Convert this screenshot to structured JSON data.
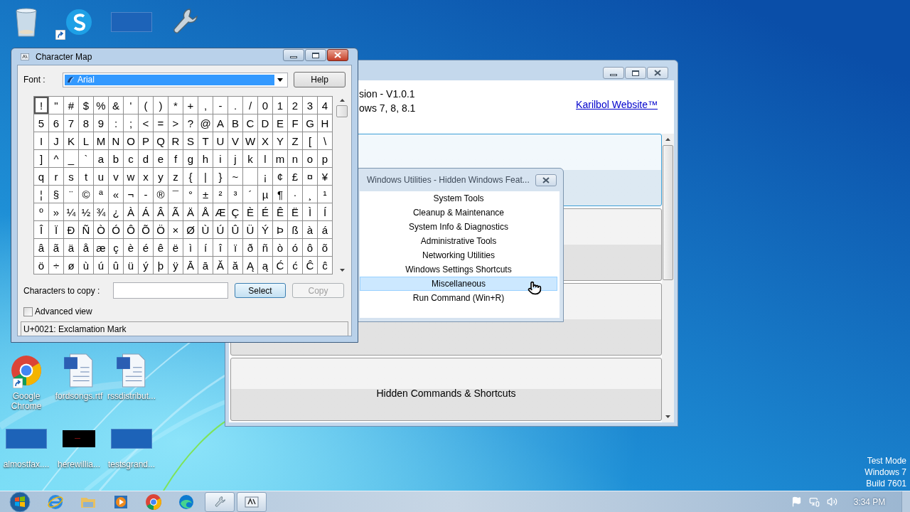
{
  "desktop": {
    "top_icons": [
      {
        "kind": "recycle-bin",
        "shortcut": false
      },
      {
        "kind": "skype",
        "shortcut": true
      },
      {
        "kind": "thumbnail",
        "shortcut": false
      },
      {
        "kind": "wrench",
        "shortcut": false
      }
    ],
    "icons": [
      {
        "kind": "chrome",
        "label": "Google Chrome",
        "shortcut": true
      },
      {
        "kind": "word",
        "label": "fordsongs.rtf",
        "shortcut": false
      },
      {
        "kind": "word",
        "label": "rssdistribut...",
        "shortcut": false
      },
      {
        "kind": "thumbnail",
        "label": "almostfax....",
        "shortcut": false
      },
      {
        "kind": "dark-thumbnail",
        "label": "herewillia...",
        "shortcut": false
      },
      {
        "kind": "thumbnail",
        "label": "testsgrand...",
        "shortcut": false
      }
    ],
    "test_mode": [
      "Test Mode",
      "Windows 7",
      "Build 7601"
    ]
  },
  "app": {
    "lines": [
      "sion - V1.0.1",
      "ows 7, 8, 8.1"
    ],
    "link": "Karilbol Website™",
    "buttons": [
      {
        "selected": true
      },
      {
        "selected": false
      },
      {
        "selected": false
      },
      {
        "label": "Hidden Commands & Shortcuts",
        "selected": false
      }
    ]
  },
  "popup": {
    "title": "Windows Utilities - Hidden Windows Feat...",
    "items": [
      {
        "label": "System Tools",
        "selected": false
      },
      {
        "label": "Cleanup & Maintenance",
        "selected": false
      },
      {
        "label": "System Info & Diagnostics",
        "selected": false
      },
      {
        "label": "Administrative Tools",
        "selected": false
      },
      {
        "label": "Networking Utilities",
        "selected": false
      },
      {
        "label": "Windows Settings Shortcuts",
        "selected": false
      },
      {
        "label": "Miscellaneous",
        "selected": true
      },
      {
        "label": "Run Command (Win+R)",
        "selected": false
      }
    ]
  },
  "charmap": {
    "title": "Character Map",
    "font_label": "Font :",
    "font_value": "Arial",
    "help": "Help",
    "grid": [
      [
        {
          "c": "!",
          "selected": true
        },
        {
          "c": "\"",
          "selected": false
        },
        {
          "c": "#",
          "selected": false
        },
        {
          "c": "$",
          "selected": false
        },
        {
          "c": "%",
          "selected": false
        },
        {
          "c": "&",
          "selected": false
        },
        {
          "c": "'",
          "selected": false
        },
        {
          "c": "(",
          "selected": false
        },
        {
          "c": ")",
          "selected": false
        },
        {
          "c": "*",
          "selected": false
        },
        {
          "c": "+",
          "selected": false
        },
        {
          "c": ",",
          "selected": false
        },
        {
          "c": "-",
          "selected": false
        },
        {
          "c": ".",
          "selected": false
        },
        {
          "c": "/",
          "selected": false
        },
        {
          "c": "0",
          "selected": false
        },
        {
          "c": "1",
          "selected": false
        },
        {
          "c": "2",
          "selected": false
        },
        {
          "c": "3",
          "selected": false
        },
        {
          "c": "4",
          "selected": false
        }
      ],
      [
        {
          "c": "5",
          "selected": false
        },
        {
          "c": "6",
          "selected": false
        },
        {
          "c": "7",
          "selected": false
        },
        {
          "c": "8",
          "selected": false
        },
        {
          "c": "9",
          "selected": false
        },
        {
          "c": ":",
          "selected": false
        },
        {
          "c": ";",
          "selected": false
        },
        {
          "c": "<",
          "selected": false
        },
        {
          "c": "=",
          "selected": false
        },
        {
          "c": ">",
          "selected": false
        },
        {
          "c": "?",
          "selected": false
        },
        {
          "c": "@",
          "selected": false
        },
        {
          "c": "A",
          "selected": false
        },
        {
          "c": "B",
          "selected": false
        },
        {
          "c": "C",
          "selected": false
        },
        {
          "c": "D",
          "selected": false
        },
        {
          "c": "E",
          "selected": false
        },
        {
          "c": "F",
          "selected": false
        },
        {
          "c": "G",
          "selected": false
        },
        {
          "c": "H",
          "selected": false
        }
      ],
      [
        {
          "c": "I",
          "selected": false
        },
        {
          "c": "J",
          "selected": false
        },
        {
          "c": "K",
          "selected": false
        },
        {
          "c": "L",
          "selected": false
        },
        {
          "c": "M",
          "selected": false
        },
        {
          "c": "N",
          "selected": false
        },
        {
          "c": "O",
          "selected": false
        },
        {
          "c": "P",
          "selected": false
        },
        {
          "c": "Q",
          "selected": false
        },
        {
          "c": "R",
          "selected": false
        },
        {
          "c": "S",
          "selected": false
        },
        {
          "c": "T",
          "selected": false
        },
        {
          "c": "U",
          "selected": false
        },
        {
          "c": "V",
          "selected": false
        },
        {
          "c": "W",
          "selected": false
        },
        {
          "c": "X",
          "selected": false
        },
        {
          "c": "Y",
          "selected": false
        },
        {
          "c": "Z",
          "selected": false
        },
        {
          "c": "[",
          "selected": false
        },
        {
          "c": "\\",
          "selected": false
        }
      ],
      [
        {
          "c": "]",
          "selected": false
        },
        {
          "c": "^",
          "selected": false
        },
        {
          "c": "_",
          "selected": false
        },
        {
          "c": "`",
          "selected": false
        },
        {
          "c": "a",
          "selected": false
        },
        {
          "c": "b",
          "selected": false
        },
        {
          "c": "c",
          "selected": false
        },
        {
          "c": "d",
          "selected": false
        },
        {
          "c": "e",
          "selected": false
        },
        {
          "c": "f",
          "selected": false
        },
        {
          "c": "g",
          "selected": false
        },
        {
          "c": "h",
          "selected": false
        },
        {
          "c": "i",
          "selected": false
        },
        {
          "c": "j",
          "selected": false
        },
        {
          "c": "k",
          "selected": false
        },
        {
          "c": "l",
          "selected": false
        },
        {
          "c": "m",
          "selected": false
        },
        {
          "c": "n",
          "selected": false
        },
        {
          "c": "o",
          "selected": false
        },
        {
          "c": "p",
          "selected": false
        }
      ],
      [
        {
          "c": "q",
          "selected": false
        },
        {
          "c": "r",
          "selected": false
        },
        {
          "c": "s",
          "selected": false
        },
        {
          "c": "t",
          "selected": false
        },
        {
          "c": "u",
          "selected": false
        },
        {
          "c": "v",
          "selected": false
        },
        {
          "c": "w",
          "selected": false
        },
        {
          "c": "x",
          "selected": false
        },
        {
          "c": "y",
          "selected": false
        },
        {
          "c": "z",
          "selected": false
        },
        {
          "c": "{",
          "selected": false
        },
        {
          "c": "|",
          "selected": false
        },
        {
          "c": "}",
          "selected": false
        },
        {
          "c": "~",
          "selected": false
        },
        {
          "selected": false
        },
        {
          "c": "¡",
          "selected": false
        },
        {
          "c": "¢",
          "selected": false
        },
        {
          "c": "£",
          "selected": false
        },
        {
          "c": "¤",
          "selected": false
        },
        {
          "c": "¥",
          "selected": false
        }
      ],
      [
        {
          "c": "¦",
          "selected": false
        },
        {
          "c": "§",
          "selected": false
        },
        {
          "c": "¨",
          "selected": false
        },
        {
          "c": "©",
          "selected": false
        },
        {
          "c": "ª",
          "selected": false
        },
        {
          "c": "«",
          "selected": false
        },
        {
          "c": "¬",
          "selected": false
        },
        {
          "c": "-",
          "selected": false
        },
        {
          "c": "®",
          "selected": false
        },
        {
          "c": "¯",
          "selected": false
        },
        {
          "c": "°",
          "selected": false
        },
        {
          "c": "±",
          "selected": false
        },
        {
          "c": "²",
          "selected": false
        },
        {
          "c": "³",
          "selected": false
        },
        {
          "c": "´",
          "selected": false
        },
        {
          "c": "µ",
          "selected": false
        },
        {
          "c": "¶",
          "selected": false
        },
        {
          "c": "·",
          "selected": false
        },
        {
          "c": "¸",
          "selected": false
        },
        {
          "c": "¹",
          "selected": false
        }
      ],
      [
        {
          "c": "º",
          "selected": false
        },
        {
          "c": "»",
          "selected": false
        },
        {
          "c": "¼",
          "selected": false
        },
        {
          "c": "½",
          "selected": false
        },
        {
          "c": "¾",
          "selected": false
        },
        {
          "c": "¿",
          "selected": false
        },
        {
          "c": "À",
          "selected": false
        },
        {
          "c": "Á",
          "selected": false
        },
        {
          "c": "Â",
          "selected": false
        },
        {
          "c": "Ã",
          "selected": false
        },
        {
          "c": "Ä",
          "selected": false
        },
        {
          "c": "Å",
          "selected": false
        },
        {
          "c": "Æ",
          "selected": false
        },
        {
          "c": "Ç",
          "selected": false
        },
        {
          "c": "È",
          "selected": false
        },
        {
          "c": "É",
          "selected": false
        },
        {
          "c": "Ê",
          "selected": false
        },
        {
          "c": "Ë",
          "selected": false
        },
        {
          "c": "Ì",
          "selected": false
        },
        {
          "c": "Í",
          "selected": false
        }
      ],
      [
        {
          "c": "Î",
          "selected": false
        },
        {
          "c": "Ï",
          "selected": false
        },
        {
          "c": "Ð",
          "selected": false
        },
        {
          "c": "Ñ",
          "selected": false
        },
        {
          "c": "Ò",
          "selected": false
        },
        {
          "c": "Ó",
          "selected": false
        },
        {
          "c": "Ô",
          "selected": false
        },
        {
          "c": "Õ",
          "selected": false
        },
        {
          "c": "Ö",
          "selected": false
        },
        {
          "c": "×",
          "selected": false
        },
        {
          "c": "Ø",
          "selected": false
        },
        {
          "c": "Ù",
          "selected": false
        },
        {
          "c": "Ú",
          "selected": false
        },
        {
          "c": "Û",
          "selected": false
        },
        {
          "c": "Ü",
          "selected": false
        },
        {
          "c": "Ý",
          "selected": false
        },
        {
          "c": "Þ",
          "selected": false
        },
        {
          "c": "ß",
          "selected": false
        },
        {
          "c": "à",
          "selected": false
        },
        {
          "c": "á",
          "selected": false
        }
      ],
      [
        {
          "c": "â",
          "selected": false
        },
        {
          "c": "ã",
          "selected": false
        },
        {
          "c": "ä",
          "selected": false
        },
        {
          "c": "å",
          "selected": false
        },
        {
          "c": "æ",
          "selected": false
        },
        {
          "c": "ç",
          "selected": false
        },
        {
          "c": "è",
          "selected": false
        },
        {
          "c": "é",
          "selected": false
        },
        {
          "c": "ê",
          "selected": false
        },
        {
          "c": "ë",
          "selected": false
        },
        {
          "c": "ì",
          "selected": false
        },
        {
          "c": "í",
          "selected": false
        },
        {
          "c": "î",
          "selected": false
        },
        {
          "c": "ï",
          "selected": false
        },
        {
          "c": "ð",
          "selected": false
        },
        {
          "c": "ñ",
          "selected": false
        },
        {
          "c": "ò",
          "selected": false
        },
        {
          "c": "ó",
          "selected": false
        },
        {
          "c": "ô",
          "selected": false
        },
        {
          "c": "õ",
          "selected": false
        }
      ],
      [
        {
          "c": "ö",
          "selected": false
        },
        {
          "c": "÷",
          "selected": false
        },
        {
          "c": "ø",
          "selected": false
        },
        {
          "c": "ù",
          "selected": false
        },
        {
          "c": "ú",
          "selected": false
        },
        {
          "c": "û",
          "selected": false
        },
        {
          "c": "ü",
          "selected": false
        },
        {
          "c": "ý",
          "selected": false
        },
        {
          "c": "þ",
          "selected": false
        },
        {
          "c": "ÿ",
          "selected": false
        },
        {
          "c": "Ā",
          "selected": false
        },
        {
          "c": "ā",
          "selected": false
        },
        {
          "c": "Ă",
          "selected": false
        },
        {
          "c": "ă",
          "selected": false
        },
        {
          "c": "Ą",
          "selected": false
        },
        {
          "c": "ą",
          "selected": false
        },
        {
          "c": "Ć",
          "selected": false
        },
        {
          "c": "ć",
          "selected": false
        },
        {
          "c": "Ĉ",
          "selected": false
        },
        {
          "c": "ĉ",
          "selected": false
        }
      ]
    ],
    "copy_label": "Characters to copy :",
    "select": "Select",
    "copy": {
      "label": "Copy",
      "disabled": true
    },
    "advanced": {
      "label": "Advanced view",
      "checked": false
    },
    "status": "U+0021: Exclamation Mark"
  },
  "taskbar": {
    "pinned": [
      {
        "kind": "ie"
      },
      {
        "kind": "explorer"
      },
      {
        "kind": "media-player"
      },
      {
        "kind": "chrome"
      },
      {
        "kind": "edge"
      }
    ],
    "running": [
      {
        "kind": "wrench"
      },
      {
        "kind": "charmap"
      }
    ],
    "tray": [
      {
        "kind": "flag"
      },
      {
        "kind": "network"
      },
      {
        "kind": "volume"
      }
    ],
    "time": "3:34 PM"
  }
}
